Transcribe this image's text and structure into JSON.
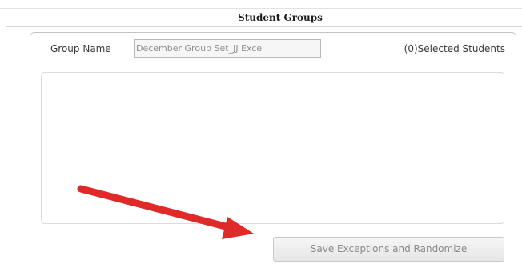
{
  "header": {
    "title": "Student Groups"
  },
  "form": {
    "group_name_label": "Group Name",
    "group_name_value": "December Group Set_JJ Exce",
    "selected_students": "(0)Selected Students"
  },
  "actions": {
    "save_label": "Save Exceptions and Randomize"
  },
  "annotation": {
    "arrow_icon": "red-arrow-icon",
    "arrow_color": "#e02a2a"
  }
}
